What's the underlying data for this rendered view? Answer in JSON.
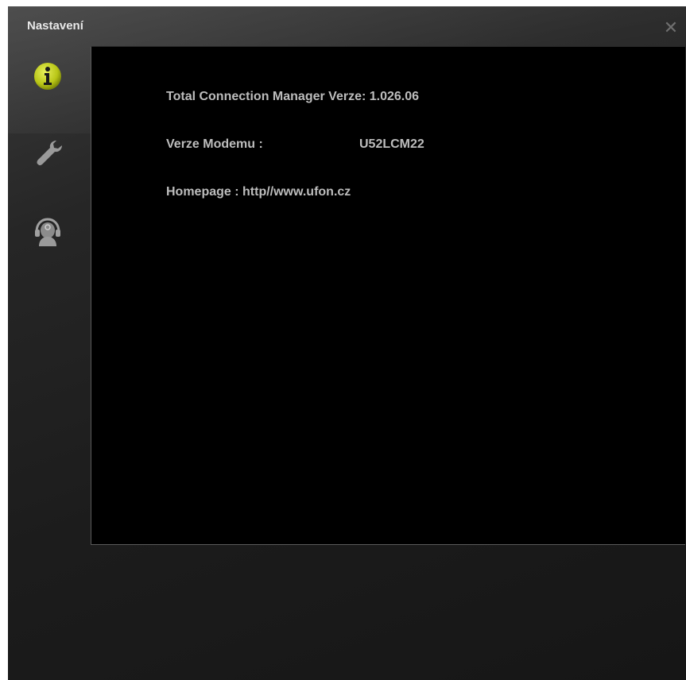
{
  "window": {
    "title": "Nastavení"
  },
  "sidebar": {
    "items": [
      {
        "name": "info",
        "icon": "info-icon",
        "color": "#c6d21c"
      },
      {
        "name": "settings",
        "icon": "wrench-icon"
      },
      {
        "name": "support",
        "icon": "operator-headset-icon"
      }
    ]
  },
  "info": {
    "version_text": "Total Connection Manager Verze: 1.026.06",
    "modem_label": "Verze Modemu :",
    "modem_value": "U52LCM22",
    "homepage_text": "Homepage : http//www.ufon.cz"
  }
}
